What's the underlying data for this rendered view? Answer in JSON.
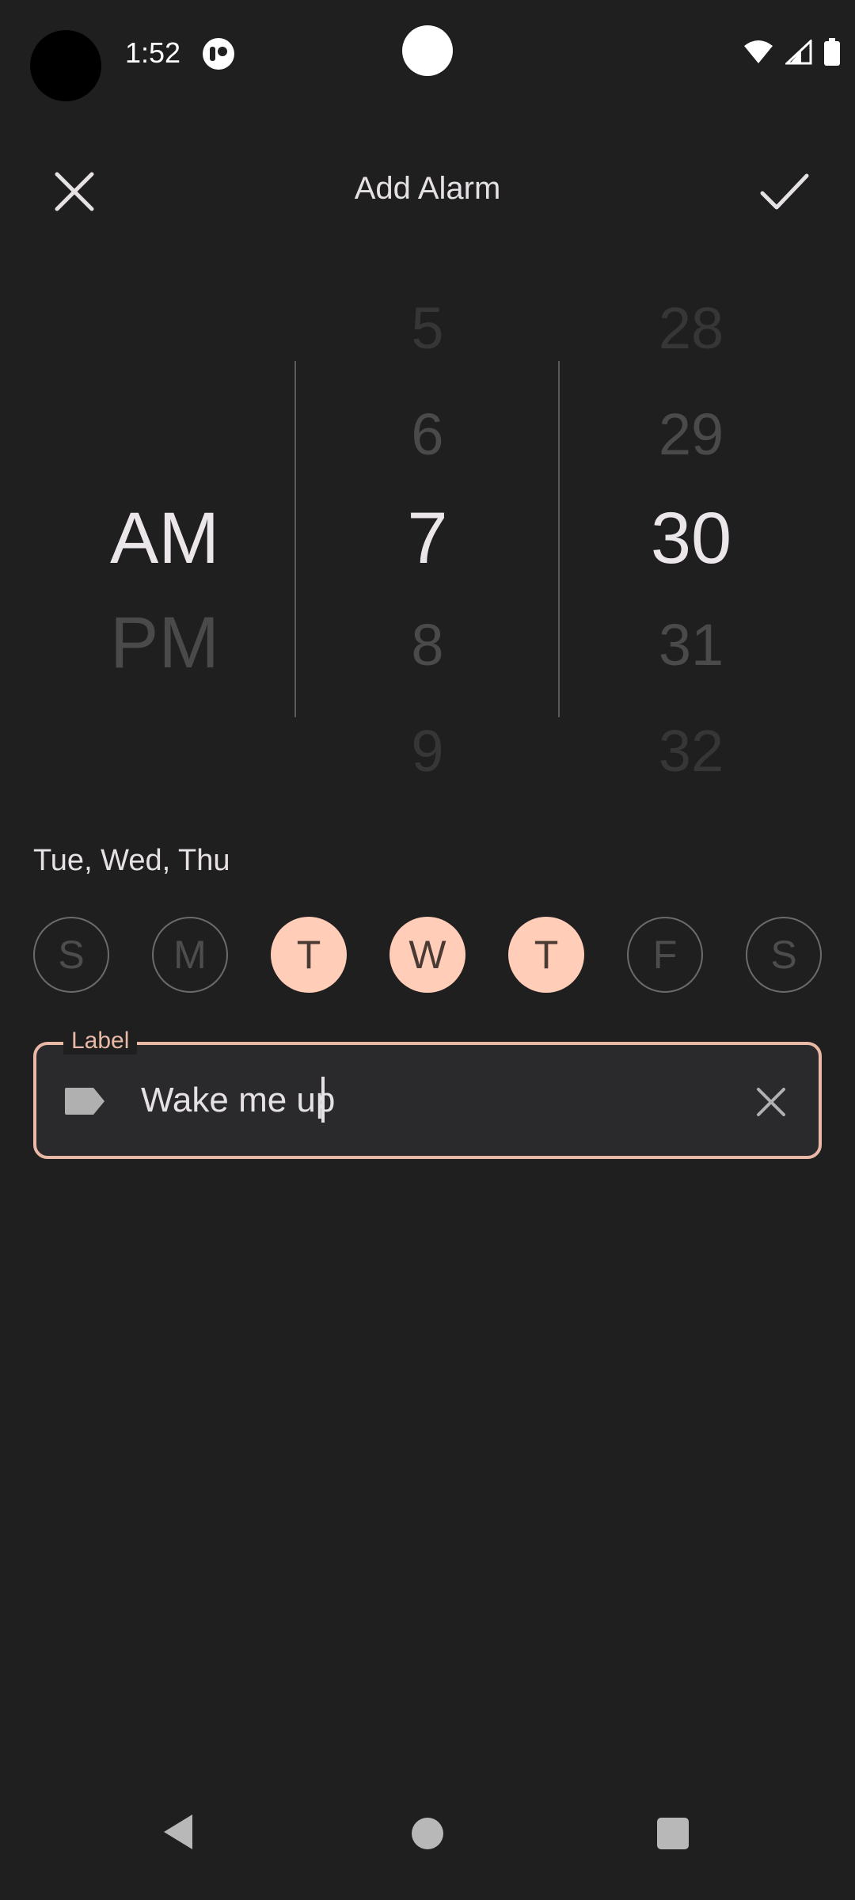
{
  "status_bar": {
    "time": "1:52"
  },
  "top_bar": {
    "title": "Add Alarm"
  },
  "time_picker": {
    "ampm": {
      "selected": "AM",
      "other": "PM"
    },
    "hours": [
      "5",
      "6",
      "7",
      "8",
      "9"
    ],
    "selected_hour": "7",
    "minutes": [
      "28",
      "29",
      "30",
      "31",
      "32"
    ],
    "selected_minute": "30"
  },
  "days": {
    "summary": "Tue, Wed, Thu",
    "items": [
      {
        "label": "S",
        "selected": false
      },
      {
        "label": "M",
        "selected": false
      },
      {
        "label": "T",
        "selected": true
      },
      {
        "label": "W",
        "selected": true
      },
      {
        "label": "T",
        "selected": true
      },
      {
        "label": "F",
        "selected": false
      },
      {
        "label": "S",
        "selected": false
      }
    ]
  },
  "label_field": {
    "legend": "Label",
    "value": "Wake me up"
  },
  "colors": {
    "accent": "#ffcdb8",
    "outline": "#e9b8a7",
    "background": "#1f1f1f"
  }
}
